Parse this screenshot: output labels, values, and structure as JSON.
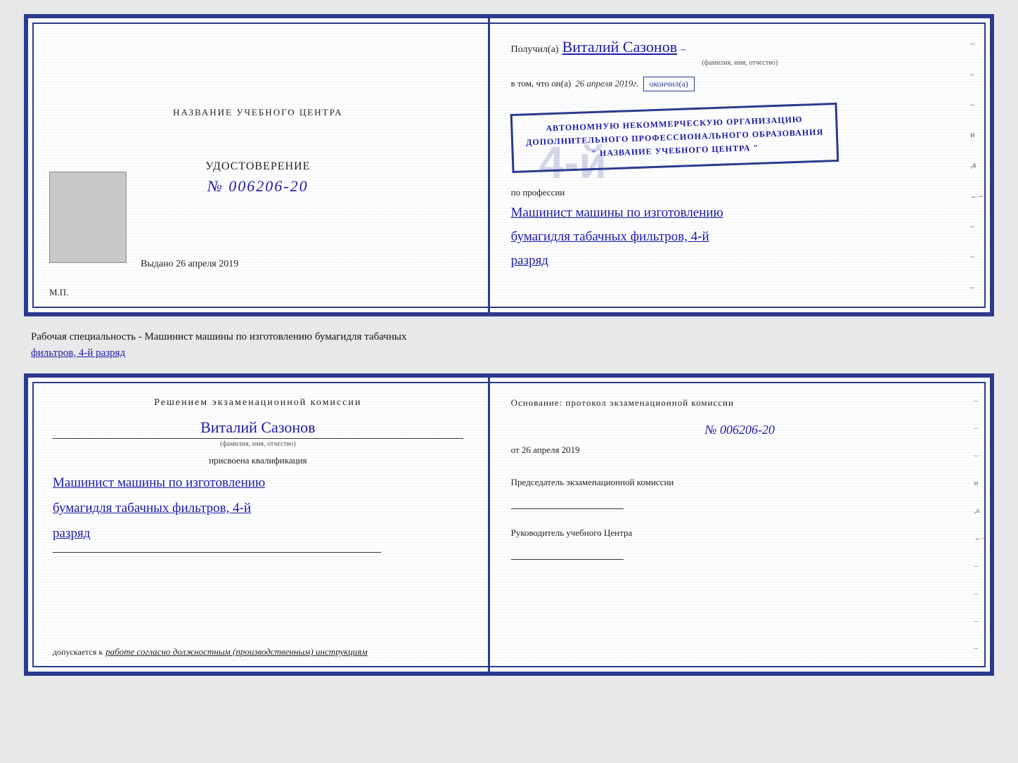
{
  "topCert": {
    "left": {
      "centerTitle": "НАЗВАНИЕ УЧЕБНОГО ЦЕНТРА",
      "udostoverenie": "УДОСТОВЕРЕНИЕ",
      "number": "№ 006206-20",
      "vydanoLabel": "Выдано",
      "vydanoDate": "26 апреля 2019",
      "mpLabel": "М.П."
    },
    "right": {
      "poluchilPrefix": "Получил(а)",
      "recipientName": "Виталий Сазонов",
      "fioLabel": "(фамилия, имя, отчество)",
      "dash": "–",
      "vtomPrefix": "в том, что он(а)",
      "vtomDate": "26 апреля 2019г.",
      "okonchilLabel": "окончил(а)",
      "stampLine1": "АВТОНОМНУЮ НЕКОММЕРЧЕСКУЮ ОРГАНИЗАЦИЮ",
      "stampLine2": "ДОПОЛНИТЕЛЬНОГО ПРОФЕССИОНАЛЬНОГО ОБРАЗОВАНИЯ",
      "stampLine3": "\" НАЗВАНИЕ УЧЕБНОГО ЦЕНТРА \"",
      "poProf": "по профессии",
      "profText1": "Машинист машины по изготовлению",
      "profText2": "бумагидля табачных фильтров, 4-й",
      "profText3": "разряд",
      "bigNumber": "4-й"
    },
    "rightDashes": [
      "-",
      "-",
      "–",
      "-",
      "и",
      ",а",
      "←",
      "-",
      "-",
      "-",
      "-",
      "-"
    ]
  },
  "betweenText": {
    "line1": "Рабочая специальность - Машинист машины по изготовлению бумагидля табачных",
    "line2": "фильтров, 4-й разряд"
  },
  "bottomCert": {
    "left": {
      "resheniemTitle": "Решением  экзаменационной  комиссии",
      "recipientName": "Виталий Сазонов",
      "fioLabel": "(фамилия, имя, отчество)",
      "prisvoenaLabel": "присвоена квалификация",
      "kvalif1": "Машинист машины по изготовлению",
      "kvalif2": "бумагидля табачных фильтров, 4-й",
      "kvalif3": "разряд",
      "dopuskaetsyaLabel": "допускается к",
      "dopuskaetsyaValue": "работе согласно должностным (производственным) инструкциям"
    },
    "right": {
      "osnovTitle": "Основание:  протокол  экзаменационной  комиссии",
      "protokolNumber": "№  006206-20",
      "otLabel": "от",
      "otDate": "26 апреля 2019",
      "predsedatelLabel": "Председатель экзаменационной комиссии",
      "rukovodLabel": "Руководитель учебного Центра"
    },
    "rightDashes": [
      "-",
      "-",
      "-",
      "и",
      ",а",
      "←",
      "-",
      "-",
      "-",
      "-",
      "-"
    ]
  }
}
